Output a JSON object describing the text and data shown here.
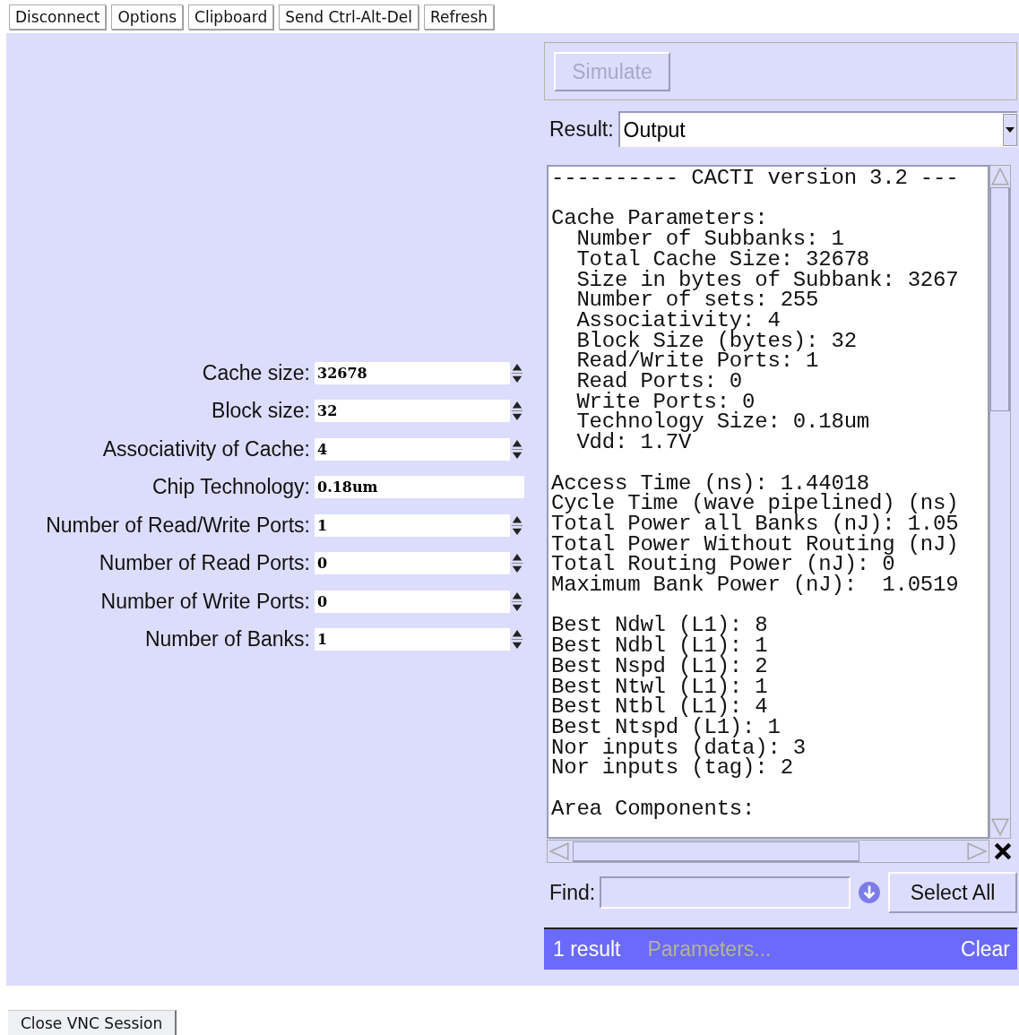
{
  "toolbar": {
    "buttons": [
      "Disconnect",
      "Options",
      "Clipboard",
      "Send Ctrl-Alt-Del",
      "Refresh"
    ]
  },
  "form": {
    "fields": [
      {
        "label": "Cache size:",
        "value": "32678",
        "kind": "spinner"
      },
      {
        "label": "Block size:",
        "value": "32",
        "kind": "spinner"
      },
      {
        "label": "Associativity of Cache:",
        "value": "4",
        "kind": "spinner"
      },
      {
        "label": "Chip Technology:",
        "value": "0.18um",
        "kind": "text"
      },
      {
        "label": "Number of Read/Write Ports:",
        "value": "1",
        "kind": "spinner"
      },
      {
        "label": "Number of Read Ports:",
        "value": "0",
        "kind": "spinner"
      },
      {
        "label": "Number of Write Ports:",
        "value": "0",
        "kind": "spinner"
      },
      {
        "label": "Number of Banks:",
        "value": "1",
        "kind": "spinner"
      }
    ]
  },
  "simulate_button": {
    "label": "Simulate",
    "disabled": true
  },
  "result": {
    "label": "Result:",
    "value": "Output"
  },
  "output": {
    "blocks": [
      [
        "---------- CACTI version 3.2 ---"
      ],
      [
        "Cache Parameters:",
        "  Number of Subbanks: 1",
        "  Total Cache Size: 32678",
        "  Size in bytes of Subbank: 3267",
        "  Number of sets: 255",
        "  Associativity: 4",
        "  Block Size (bytes): 32",
        "  Read/Write Ports: 1",
        "  Read Ports: 0",
        "  Write Ports: 0",
        "  Technology Size: 0.18um",
        "  Vdd: 1.7V"
      ],
      [
        "Access Time (ns): 1.44018",
        "Cycle Time (wave pipelined) (ns)",
        "Total Power all Banks (nJ): 1.05",
        "Total Power Without Routing (nJ)",
        "Total Routing Power (nJ): 0",
        "Maximum Bank Power (nJ):  1.0519"
      ],
      [
        "Best Ndwl (L1): 8",
        "Best Ndbl (L1): 1",
        "Best Nspd (L1): 2",
        "Best Ntwl (L1): 1",
        "Best Ntbl (L1): 4",
        "Best Ntspd (L1): 1",
        "Nor inputs (data): 3",
        "Nor inputs (tag): 2"
      ],
      [
        "Area Components:"
      ]
    ]
  },
  "find": {
    "label": "Find:"
  },
  "select_all_button": {
    "label": "Select All"
  },
  "status_bar": {
    "count": "1 result",
    "query": "Parameters...",
    "clear": "Clear"
  },
  "close_button": {
    "label": "Close VNC Session"
  }
}
